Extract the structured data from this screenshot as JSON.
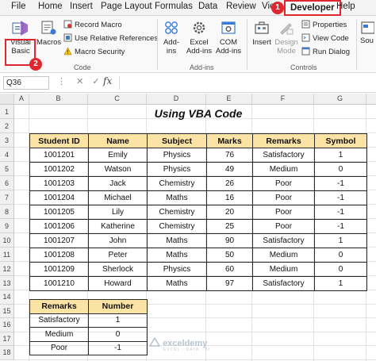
{
  "menu": {
    "items": [
      "File",
      "Home",
      "Insert",
      "Page Layout",
      "Formulas",
      "Data",
      "Review",
      "View",
      "Developer",
      "Help"
    ],
    "active": "Developer"
  },
  "annotations": {
    "step1": "1",
    "step2": "2",
    "accent": "#e0262f"
  },
  "ribbon": {
    "code": {
      "visual_basic_1": "Visual",
      "visual_basic_2": "Basic",
      "macros": "Macros",
      "record_macro": "Record Macro",
      "use_relative": "Use Relative References",
      "macro_security": "Macro Security",
      "group_label": "Code"
    },
    "addins": {
      "addins_1": "Add-",
      "addins_2": "ins",
      "excel_addins_1": "Excel",
      "excel_addins_2": "Add-ins",
      "com_addins_1": "COM",
      "com_addins_2": "Add-ins",
      "group_label": "Add-ins"
    },
    "controls": {
      "insert": "Insert",
      "design_mode_1": "Design",
      "design_mode_2": "Mode",
      "properties": "Properties",
      "view_code": "View Code",
      "run_dialog": "Run Dialog",
      "group_label": "Controls"
    },
    "source_partial": "Sou"
  },
  "formula_bar": {
    "name_box": "Q36",
    "fx": "fx",
    "value": ""
  },
  "columns": [
    "A",
    "B",
    "C",
    "D",
    "E",
    "F",
    "G"
  ],
  "rows": [
    "1",
    "2",
    "3",
    "4",
    "5",
    "6",
    "7",
    "8",
    "9",
    "10",
    "11",
    "12",
    "13",
    "14",
    "15",
    "16",
    "17",
    "18"
  ],
  "sheet": {
    "title": "Using VBA Code",
    "main_table": {
      "headers": [
        "Student ID",
        "Name",
        "Subject",
        "Marks",
        "Remarks",
        "Symbol"
      ],
      "rows": [
        [
          "1001201",
          "Emily",
          "Physics",
          "76",
          "Satisfactory",
          "1"
        ],
        [
          "1001202",
          "Watson",
          "Physics",
          "49",
          "Medium",
          "0"
        ],
        [
          "1001203",
          "Jack",
          "Chemistry",
          "26",
          "Poor",
          "-1"
        ],
        [
          "1001204",
          "Michael",
          "Maths",
          "16",
          "Poor",
          "-1"
        ],
        [
          "1001205",
          "Lily",
          "Chemistry",
          "20",
          "Poor",
          "-1"
        ],
        [
          "1001206",
          "Katherine",
          "Chemistry",
          "25",
          "Poor",
          "-1"
        ],
        [
          "1001207",
          "John",
          "Maths",
          "90",
          "Satisfactory",
          "1"
        ],
        [
          "1001208",
          "Peter",
          "Maths",
          "50",
          "Medium",
          "0"
        ],
        [
          "1001209",
          "Sherlock",
          "Physics",
          "60",
          "Medium",
          "0"
        ],
        [
          "1001210",
          "Howard",
          "Maths",
          "97",
          "Satisfactory",
          "1"
        ]
      ]
    },
    "summary_table": {
      "headers": [
        "Remarks",
        "Number"
      ],
      "rows": [
        [
          "Satisfactory",
          "1"
        ],
        [
          "Medium",
          "0"
        ],
        [
          "Poor",
          "-1"
        ]
      ]
    },
    "header_fill": "#fbe2a5"
  },
  "watermark": {
    "brand": "exceldemy",
    "tagline": "EXCEL · DATA · BI"
  }
}
